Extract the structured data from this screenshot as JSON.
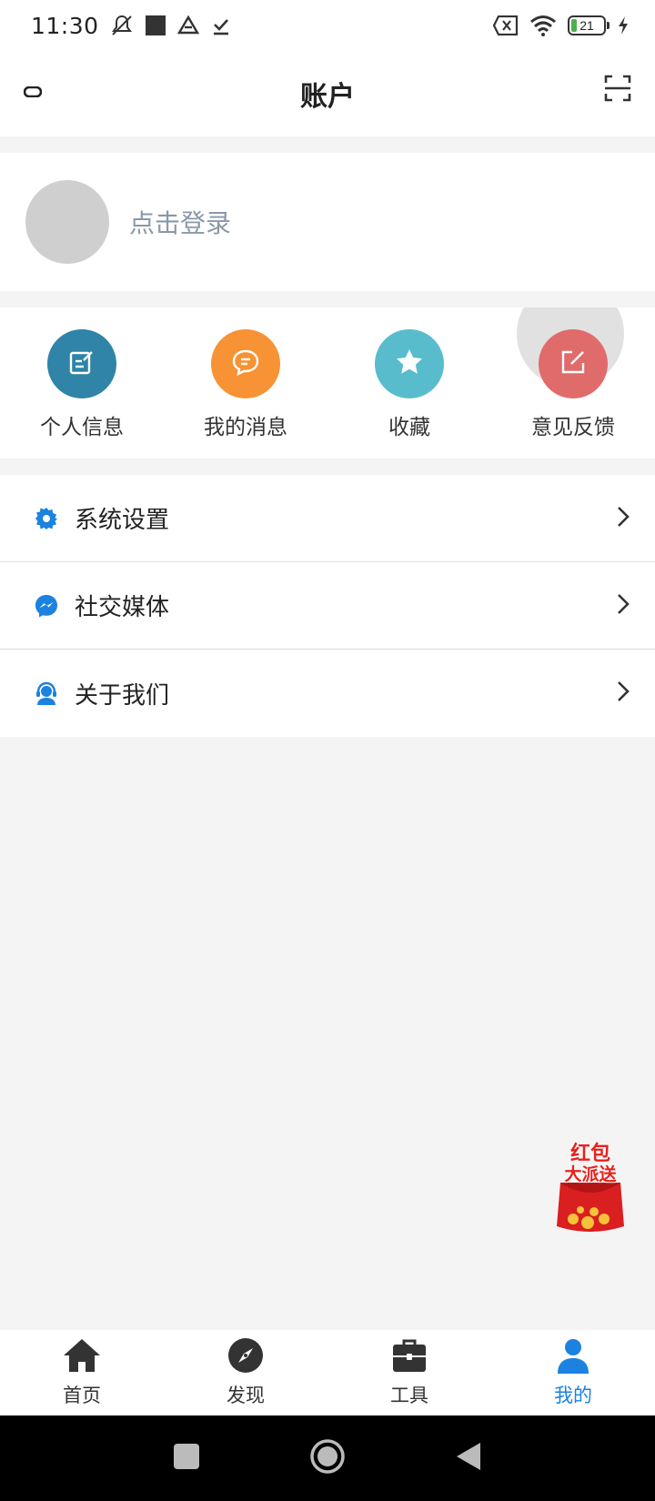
{
  "status_bar": {
    "time": "11:30",
    "battery_level": "21",
    "left_icons": [
      "mute-icon",
      "square-icon",
      "drive-icon",
      "download-done-icon"
    ],
    "right_icons": [
      "no-sim-icon",
      "wifi-icon",
      "battery-icon",
      "charging-icon"
    ]
  },
  "header": {
    "title": "账户",
    "left_icon": "minus-icon",
    "right_icon": "scan-icon"
  },
  "profile": {
    "login_text": "点击登录"
  },
  "quick_actions": [
    {
      "label": "个人信息",
      "icon": "edit-note-icon",
      "color": "#2f84a8"
    },
    {
      "label": "我的消息",
      "icon": "chat-bubble-icon",
      "color": "#f79334"
    },
    {
      "label": "收藏",
      "icon": "star-icon",
      "color": "#58bccc"
    },
    {
      "label": "意见反馈",
      "icon": "edit-square-icon",
      "color": "#e06b6b"
    }
  ],
  "menu": [
    {
      "label": "系统设置",
      "icon": "gear-icon"
    },
    {
      "label": "社交媒体",
      "icon": "messenger-icon"
    },
    {
      "label": "关于我们",
      "icon": "support-agent-icon"
    }
  ],
  "red_packet": {
    "line1": "红包",
    "line2": "大派送"
  },
  "bottom_nav": [
    {
      "label": "首页",
      "icon": "home-icon",
      "active": false
    },
    {
      "label": "发现",
      "icon": "compass-icon",
      "active": false
    },
    {
      "label": "工具",
      "icon": "toolbox-icon",
      "active": false
    },
    {
      "label": "我的",
      "icon": "person-icon",
      "active": true
    }
  ],
  "colors": {
    "accent": "#1b82e0",
    "menu_icon": "#1b82e0",
    "background": "#f4f4f4"
  }
}
